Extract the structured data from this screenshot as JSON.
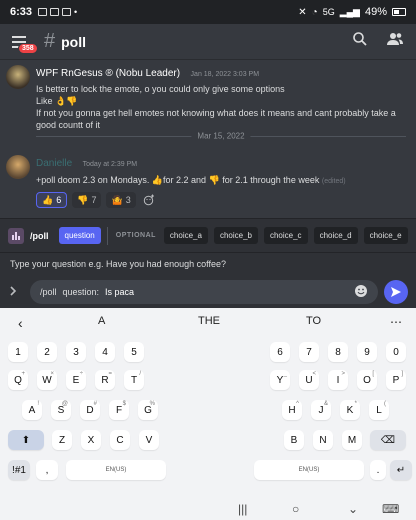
{
  "status_bar": {
    "time": "6:33",
    "network": "5G",
    "battery": "49%"
  },
  "header": {
    "channel": "poll",
    "notification_count": "358"
  },
  "messages": [
    {
      "author": "WPF RnGesus ® (Nobu Leader)",
      "timestamp": "Jan 18, 2022 3:03 PM",
      "lines": [
        "Is better to lock the emote, o you could only give some options",
        "Like 👌👎",
        "If not you gonna get hell emotes not knowing what does it means and cant probably take a",
        "good countt of it"
      ]
    },
    {
      "author": "Danielle",
      "timestamp": "Today at 2:39 PM",
      "text": "+poll doom 2.3 on Mondays. 👍for 2.2 and 👎 for 2.1 through the week",
      "edited": "(edited)",
      "reactions": [
        {
          "emoji": "👍",
          "count": "6"
        },
        {
          "emoji": "👎",
          "count": "7"
        },
        {
          "emoji": "🤷",
          "count": "3"
        }
      ]
    }
  ],
  "date_divider": "Mar 15, 2022",
  "command_bar": {
    "name": "/poll",
    "active_option": "question",
    "optional_label": "OPTIONAL",
    "options": [
      "choice_a",
      "choice_b",
      "choice_c",
      "choice_d",
      "choice_e"
    ]
  },
  "hint": "Type your question e.g. Have you had enough coffee?",
  "input": {
    "command": "/poll",
    "param_label": "question:",
    "value": "Is paca"
  },
  "keyboard": {
    "suggestions": [
      "A",
      "THE",
      "TO"
    ],
    "rows": {
      "numbers": [
        "1",
        "2",
        "3",
        "4",
        "5",
        "6",
        "7",
        "8",
        "9",
        "0"
      ],
      "row1": [
        "Q",
        "W",
        "E",
        "R",
        "T",
        "Y",
        "U",
        "I",
        "O",
        "P"
      ],
      "row2": [
        "A",
        "S",
        "D",
        "F",
        "G",
        "H",
        "J",
        "K",
        "L"
      ],
      "row3": [
        "Z",
        "X",
        "C",
        "V",
        "B",
        "N",
        "M"
      ]
    },
    "row1_hints": [
      "+",
      "×",
      "÷",
      "=",
      "/",
      "_",
      "<",
      ">",
      "[",
      "]"
    ],
    "row2_hints": [
      "!",
      "@",
      "#",
      "$",
      "%",
      "^",
      "&",
      "*",
      "(",
      ")"
    ],
    "symbols_label": "!#1",
    "comma": ",",
    "period": ".",
    "space_label": "EN(US)"
  },
  "colors": {
    "accent": "#5865f2",
    "background": "#36393f",
    "panel": "#2f3136"
  }
}
